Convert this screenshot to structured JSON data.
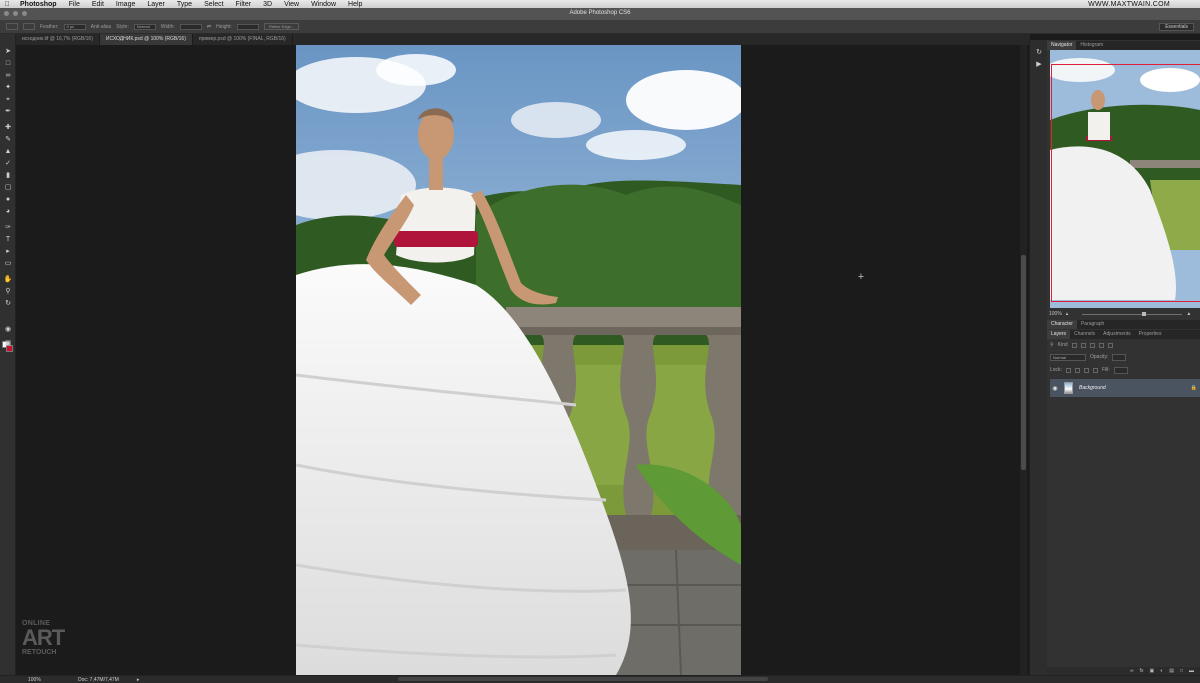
{
  "menubar": {
    "apple_icon": "apple-icon",
    "items": [
      {
        "label": "Photoshop",
        "bold": true
      },
      {
        "label": "File"
      },
      {
        "label": "Edit"
      },
      {
        "label": "Image"
      },
      {
        "label": "Layer"
      },
      {
        "label": "Type"
      },
      {
        "label": "Select"
      },
      {
        "label": "Filter"
      },
      {
        "label": "3D"
      },
      {
        "label": "View"
      },
      {
        "label": "Window"
      },
      {
        "label": "Help"
      }
    ],
    "site": "WWW.MAXTWAIN.COM"
  },
  "window": {
    "title": "Adobe Photoshop CS6"
  },
  "options": {
    "feather_label": "Feather:",
    "feather_value": "0 px",
    "anti_alias": "Anti-alias",
    "style_label": "Style:",
    "style_value": "Normal",
    "width_label": "Width:",
    "height_label": "Height:",
    "refine_edge": "Refine Edge...",
    "workspace": "Essentials"
  },
  "doc_tabs": [
    {
      "label": "исходник.tif @ 16,7% (RGB/16)",
      "active": false
    },
    {
      "label": "ИСХОДНИК.psd @ 100% (RGB/16)",
      "active": true
    },
    {
      "label": "пример.psd @ 100% (FINAL, RGB/16)",
      "active": false
    }
  ],
  "colors": {
    "foreground": "#ffffff",
    "background": "#c8102e",
    "ui_dark": "#1b1b1b",
    "panel": "#323232",
    "selection": "#4a5460"
  },
  "navigator": {
    "tabs": [
      "Navigator",
      "Histogram"
    ],
    "zoom": "100%"
  },
  "character": {
    "tabs": [
      "Character",
      "Paragraph"
    ]
  },
  "layers": {
    "tabs": [
      "Layers",
      "Channels",
      "Adjustments",
      "Properties"
    ],
    "kind_label": "Kind",
    "blend_mode": "Normal",
    "opacity_label": "Opacity:",
    "lock_label": "Lock:",
    "fill_label": "Fill:",
    "items": [
      {
        "name": "Background",
        "visible": true,
        "locked": true
      }
    ]
  },
  "status": {
    "zoom": "100%",
    "doc": "Doc: 7,47M/7,47M"
  },
  "watermark": {
    "line1": "ONLINE",
    "line2": "ART",
    "line3": "RETOUCH"
  }
}
